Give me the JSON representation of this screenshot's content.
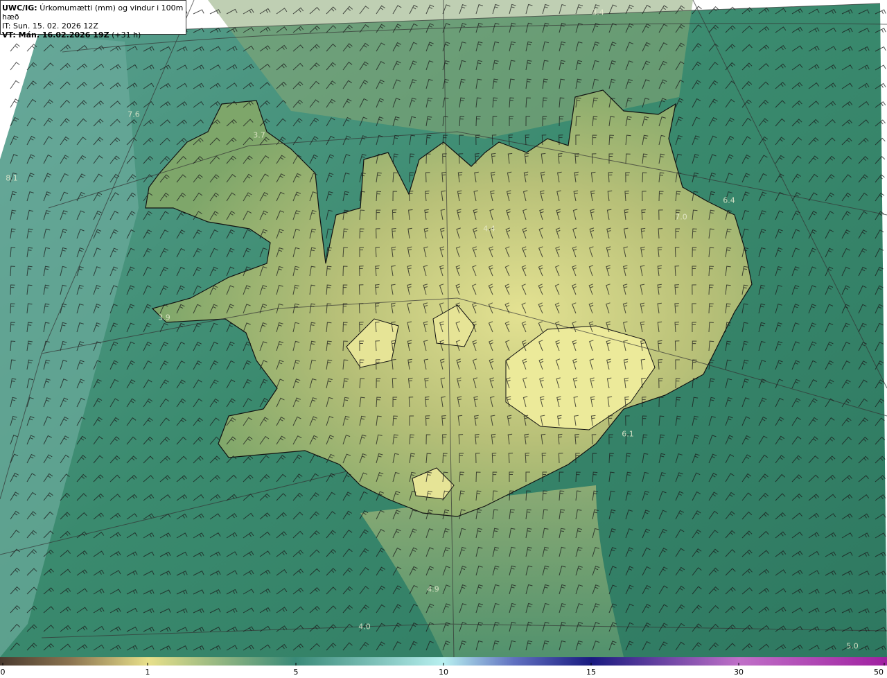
{
  "header": {
    "model": "UWC/IG:",
    "title": "Úrkomumætti (mm) og vindur i 100m hæð",
    "it_line": "IT: Sun. 15. 02. 2026 12Z",
    "vt_prefix": "VT: Mán. 16.02.2026 19Z",
    "vt_suffix": "(+31 h)"
  },
  "colorbar": {
    "ticks": [
      "0",
      "1",
      "5",
      "10",
      "15",
      "30",
      "50"
    ],
    "colors": [
      "#4a3a2e",
      "#a89060",
      "#e8e08a",
      "#3a8a78",
      "#b8f0f0",
      "#1a1a80",
      "#b060c0",
      "#a020a0"
    ]
  },
  "map_values": [
    "3.4",
    "7.6",
    "3.7",
    "8.1",
    "6.4",
    "7.0",
    "4.4",
    "3.9",
    "6.1",
    "4.9",
    "4.0",
    "5.0"
  ],
  "colors": {
    "sea_dark": "#2f7a62",
    "sea_mid": "#3f8f72",
    "sea_light": "#6aa89a",
    "land_low": "#8aa868",
    "land_high": "#e0e090",
    "coast": "#111111"
  },
  "icons": {
    "barbs": "wind-barb-icon"
  }
}
